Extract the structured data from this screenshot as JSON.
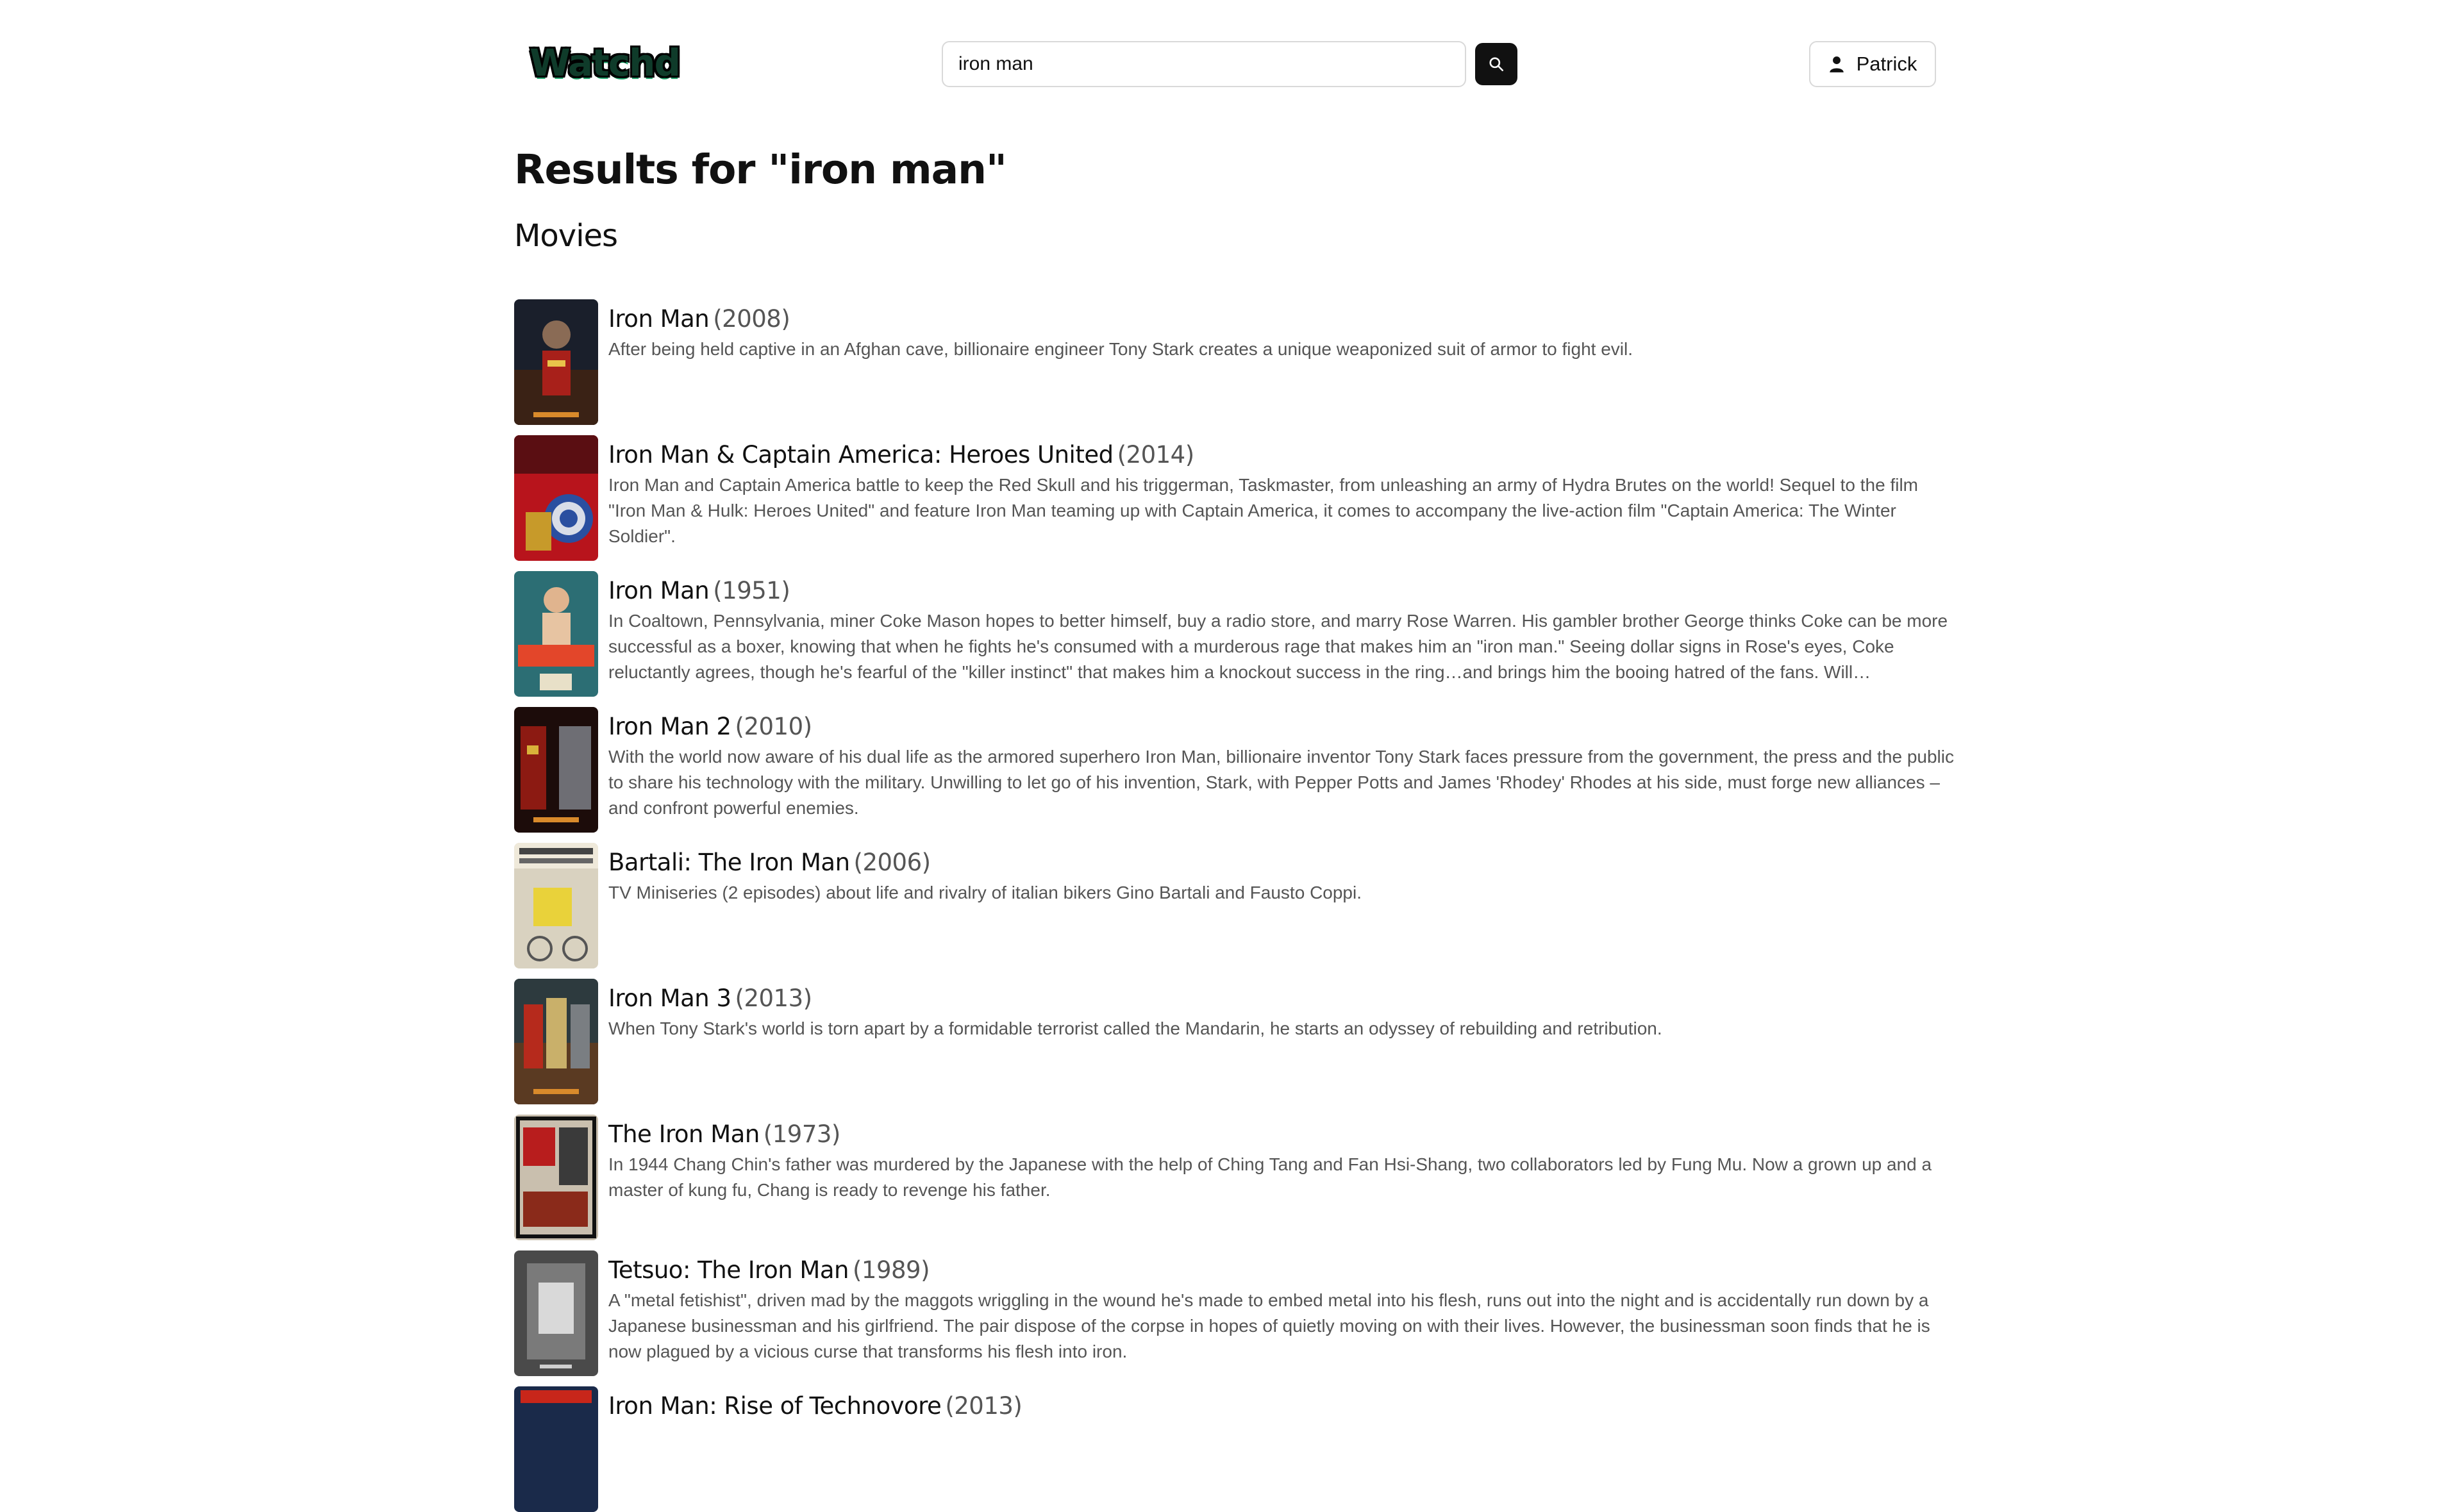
{
  "header": {
    "logo": "Watchd",
    "search": {
      "value": "iron man",
      "placeholder": ""
    },
    "search_button_icon": "search-icon",
    "user": {
      "name": "Patrick",
      "icon": "user-icon"
    }
  },
  "page_title": "Results for \"iron man\"",
  "section_title": "Movies",
  "results": [
    {
      "title": "Iron Man",
      "year": "(2008)",
      "description": "After being held captive in an Afghan cave, billionaire engineer Tony Stark creates a unique weaponized suit of armor to fight evil."
    },
    {
      "title": "Iron Man & Captain America: Heroes United",
      "year": "(2014)",
      "description": "Iron Man and Captain America battle to keep the Red Skull and his triggerman, Taskmaster, from unleashing an army of Hydra Brutes on the world! Sequel to the film \"Iron Man & Hulk: Heroes United\" and feature Iron Man teaming up with Captain America, it comes to accompany the live-action film \"Captain America: The Winter Soldier\"."
    },
    {
      "title": "Iron Man",
      "year": "(1951)",
      "description": "In Coaltown, Pennsylvania, miner Coke Mason hopes to better himself, buy a radio store, and marry Rose Warren. His gambler brother George thinks Coke can be more successful as a boxer, knowing that when he fights he's consumed with a murderous rage that makes him an \"iron man.\" Seeing dollar signs in Rose's eyes, Coke reluctantly agrees, though he's fearful of the \"killer instinct\" that makes him a knockout success in the ring…and brings him the booing hatred of the fans. Will…"
    },
    {
      "title": "Iron Man 2",
      "year": "(2010)",
      "description": "With the world now aware of his dual life as the armored superhero Iron Man, billionaire inventor Tony Stark faces pressure from the government, the press and the public to share his technology with the military. Unwilling to let go of his invention, Stark, with Pepper Potts and James 'Rhodey' Rhodes at his side, must forge new alliances – and confront powerful enemies."
    },
    {
      "title": "Bartali: The Iron Man",
      "year": "(2006)",
      "description": "TV Miniseries (2 episodes) about life and rivalry of italian bikers Gino Bartali and Fausto Coppi."
    },
    {
      "title": "Iron Man 3",
      "year": "(2013)",
      "description": "When Tony Stark's world is torn apart by a formidable terrorist called the Mandarin, he starts an odyssey of rebuilding and retribution."
    },
    {
      "title": "The Iron Man",
      "year": "(1973)",
      "description": "In 1944 Chang Chin's father was murdered by the Japanese with the help of Ching Tang and Fan Hsi-Shang, two collaborators led by Fung Mu. Now a grown up and a master of kung fu, Chang is ready to revenge his father."
    },
    {
      "title": "Tetsuo: The Iron Man",
      "year": "(1989)",
      "description": "A \"metal fetishist\", driven mad by the maggots wriggling in the wound he's made to embed metal into his flesh, runs out into the night and is accidentally run down by a Japanese businessman and his girlfriend. The pair dispose of the corpse in hopes of quietly moving on with their lives. However, the businessman soon finds that he is now plagued by a vicious curse that transforms his flesh into iron."
    },
    {
      "title": "Iron Man: Rise of Technovore",
      "year": "(2013)",
      "description": ""
    }
  ],
  "poster_images": [
    "Iron Man (2008) poster",
    "Iron Man & Captain America poster",
    "Iron Man (1951) poster",
    "Iron Man 2 poster",
    "Bartali poster",
    "Iron Man 3 poster",
    "The Iron Man (1973) poster",
    "Tetsuo poster",
    "Rise of Technovore poster"
  ]
}
